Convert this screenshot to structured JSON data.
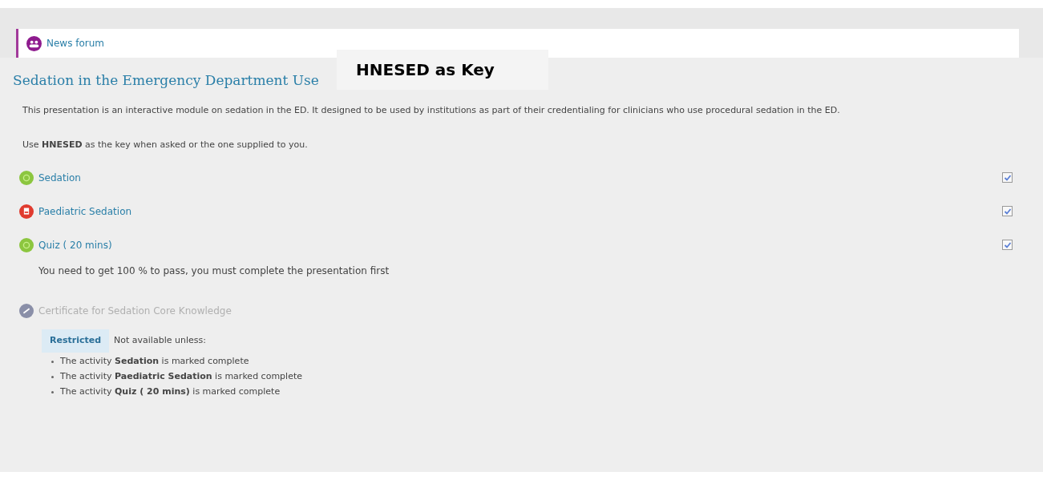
{
  "news_forum": {
    "label": "News forum"
  },
  "section": {
    "title": "Sedation in the Emergency Department Use",
    "key_note": "HNESED as Key",
    "summary": "This presentation is an interactive module on sedation in the ED. It designed to be used by institutions as part of their credentialing for clinicians who use procedural sedation in the ED.",
    "key_line": "Use **HNESED** as the key when asked or the one supplied to you."
  },
  "activities": [
    {
      "kind": "package",
      "name": "Sedation",
      "disabled": false,
      "checked": true
    },
    {
      "kind": "pdf",
      "name": "Paediatric Sedation",
      "disabled": false,
      "checked": true
    },
    {
      "kind": "package",
      "name": "Quiz ( 20 mins)",
      "disabled": false,
      "checked": true,
      "description": "You need to get 100 % to pass, you must complete the presentation first"
    },
    {
      "kind": "certificate",
      "name": "Certificate for Sedation Core Knowledge",
      "disabled": true,
      "restriction": {
        "badge": "Restricted",
        "intro": "Not available unless:",
        "conditions": [
          "The activity **Sedation** is marked complete",
          "The activity **Paediatric Sedation** is marked complete",
          "The activity **Quiz ( 20 mins)** is marked complete"
        ]
      }
    }
  ]
}
